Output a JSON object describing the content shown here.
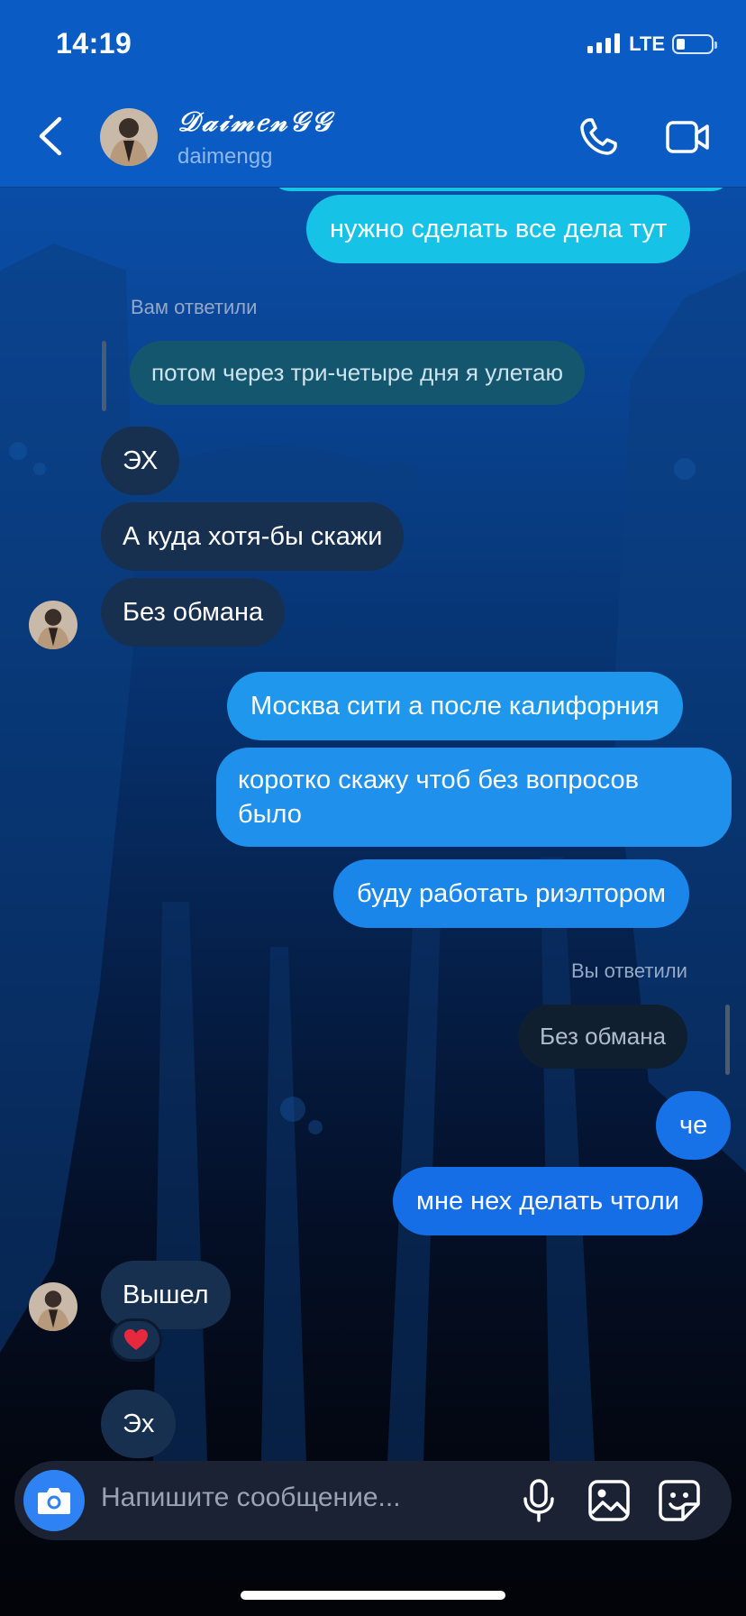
{
  "status_bar": {
    "time": "14:19",
    "network": "LTE"
  },
  "header": {
    "name": "𝒟𝒶𝒾𝓂𝑒𝓃𝒢𝒢",
    "username": "daimengg"
  },
  "messages": {
    "out_1": "нужно сделать все дела тут",
    "reply_1_label": "Вам ответили",
    "reply_1_quote": "потом через три-четыре дня я  улетаю",
    "in_1": "ЭХ",
    "in_2": "А куда хотя-бы скажи",
    "in_3": "Без обмана",
    "out_2": "Москва сити а после калифорния",
    "out_3_line1": "коротко скажу чтоб без вопросов",
    "out_3_line2": "было",
    "out_4": "буду работать риэлтором",
    "reply_2_label": "Вы ответили",
    "reply_2_quote": "Без обмана",
    "out_5": "че",
    "out_6": "мне нех делать чтоли",
    "in_4": "Вышел",
    "in_4_reaction": "❤️",
    "in_5": "Эх"
  },
  "composer": {
    "placeholder": "Напишите сообщение..."
  },
  "colors": {
    "header": "#0a5cc4",
    "bubble_out_top": "#14c2e6",
    "bubble_out_mid": "#1e94ec",
    "bubble_out_bottom": "#156ee6",
    "bubble_in": "#17304f",
    "camera_button": "#2f82f4"
  }
}
